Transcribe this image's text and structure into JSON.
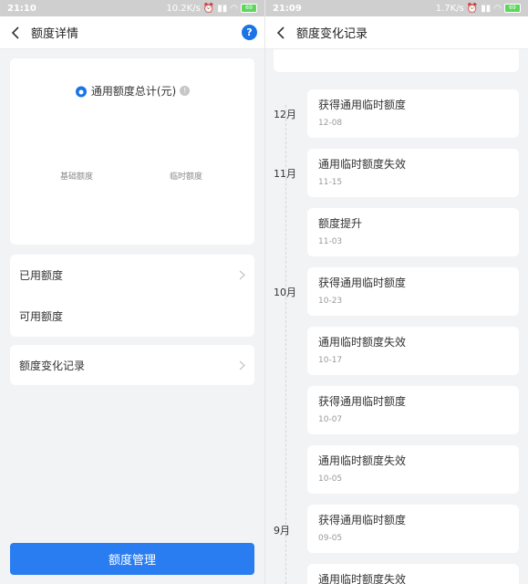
{
  "left": {
    "status": {
      "time": "21:10",
      "speed": "10.2K/s",
      "battery": "69"
    },
    "nav": {
      "title": "额度详情",
      "help": "?"
    },
    "summary": {
      "title": "通用额度总计(元)",
      "base_label": "基础额度",
      "temp_label": "临时额度"
    },
    "rows": {
      "used": "已用额度",
      "available": "可用额度",
      "records": "额度变化记录"
    },
    "button": "额度管理"
  },
  "right": {
    "status": {
      "time": "21:09",
      "speed": "1.7K/s",
      "battery": "69"
    },
    "nav": {
      "title": "额度变化记录"
    },
    "months": {
      "m12": "12月",
      "m11": "11月",
      "m10": "10月",
      "m9": "9月"
    },
    "entries": [
      {
        "title": "获得通用临时额度",
        "date": "12-08"
      },
      {
        "title": "通用临时额度失效",
        "date": "11-15"
      },
      {
        "title": "额度提升",
        "date": "11-03"
      },
      {
        "title": "获得通用临时额度",
        "date": "10-23"
      },
      {
        "title": "通用临时额度失效",
        "date": "10-17"
      },
      {
        "title": "获得通用临时额度",
        "date": "10-07"
      },
      {
        "title": "通用临时额度失效",
        "date": "10-05"
      },
      {
        "title": "获得通用临时额度",
        "date": "09-05"
      },
      {
        "title": "通用临时额度失效",
        "date": ""
      }
    ]
  },
  "colors": {
    "accent": "#2a7df0",
    "help": "#1a73e8",
    "background": "#f2f3f5"
  }
}
